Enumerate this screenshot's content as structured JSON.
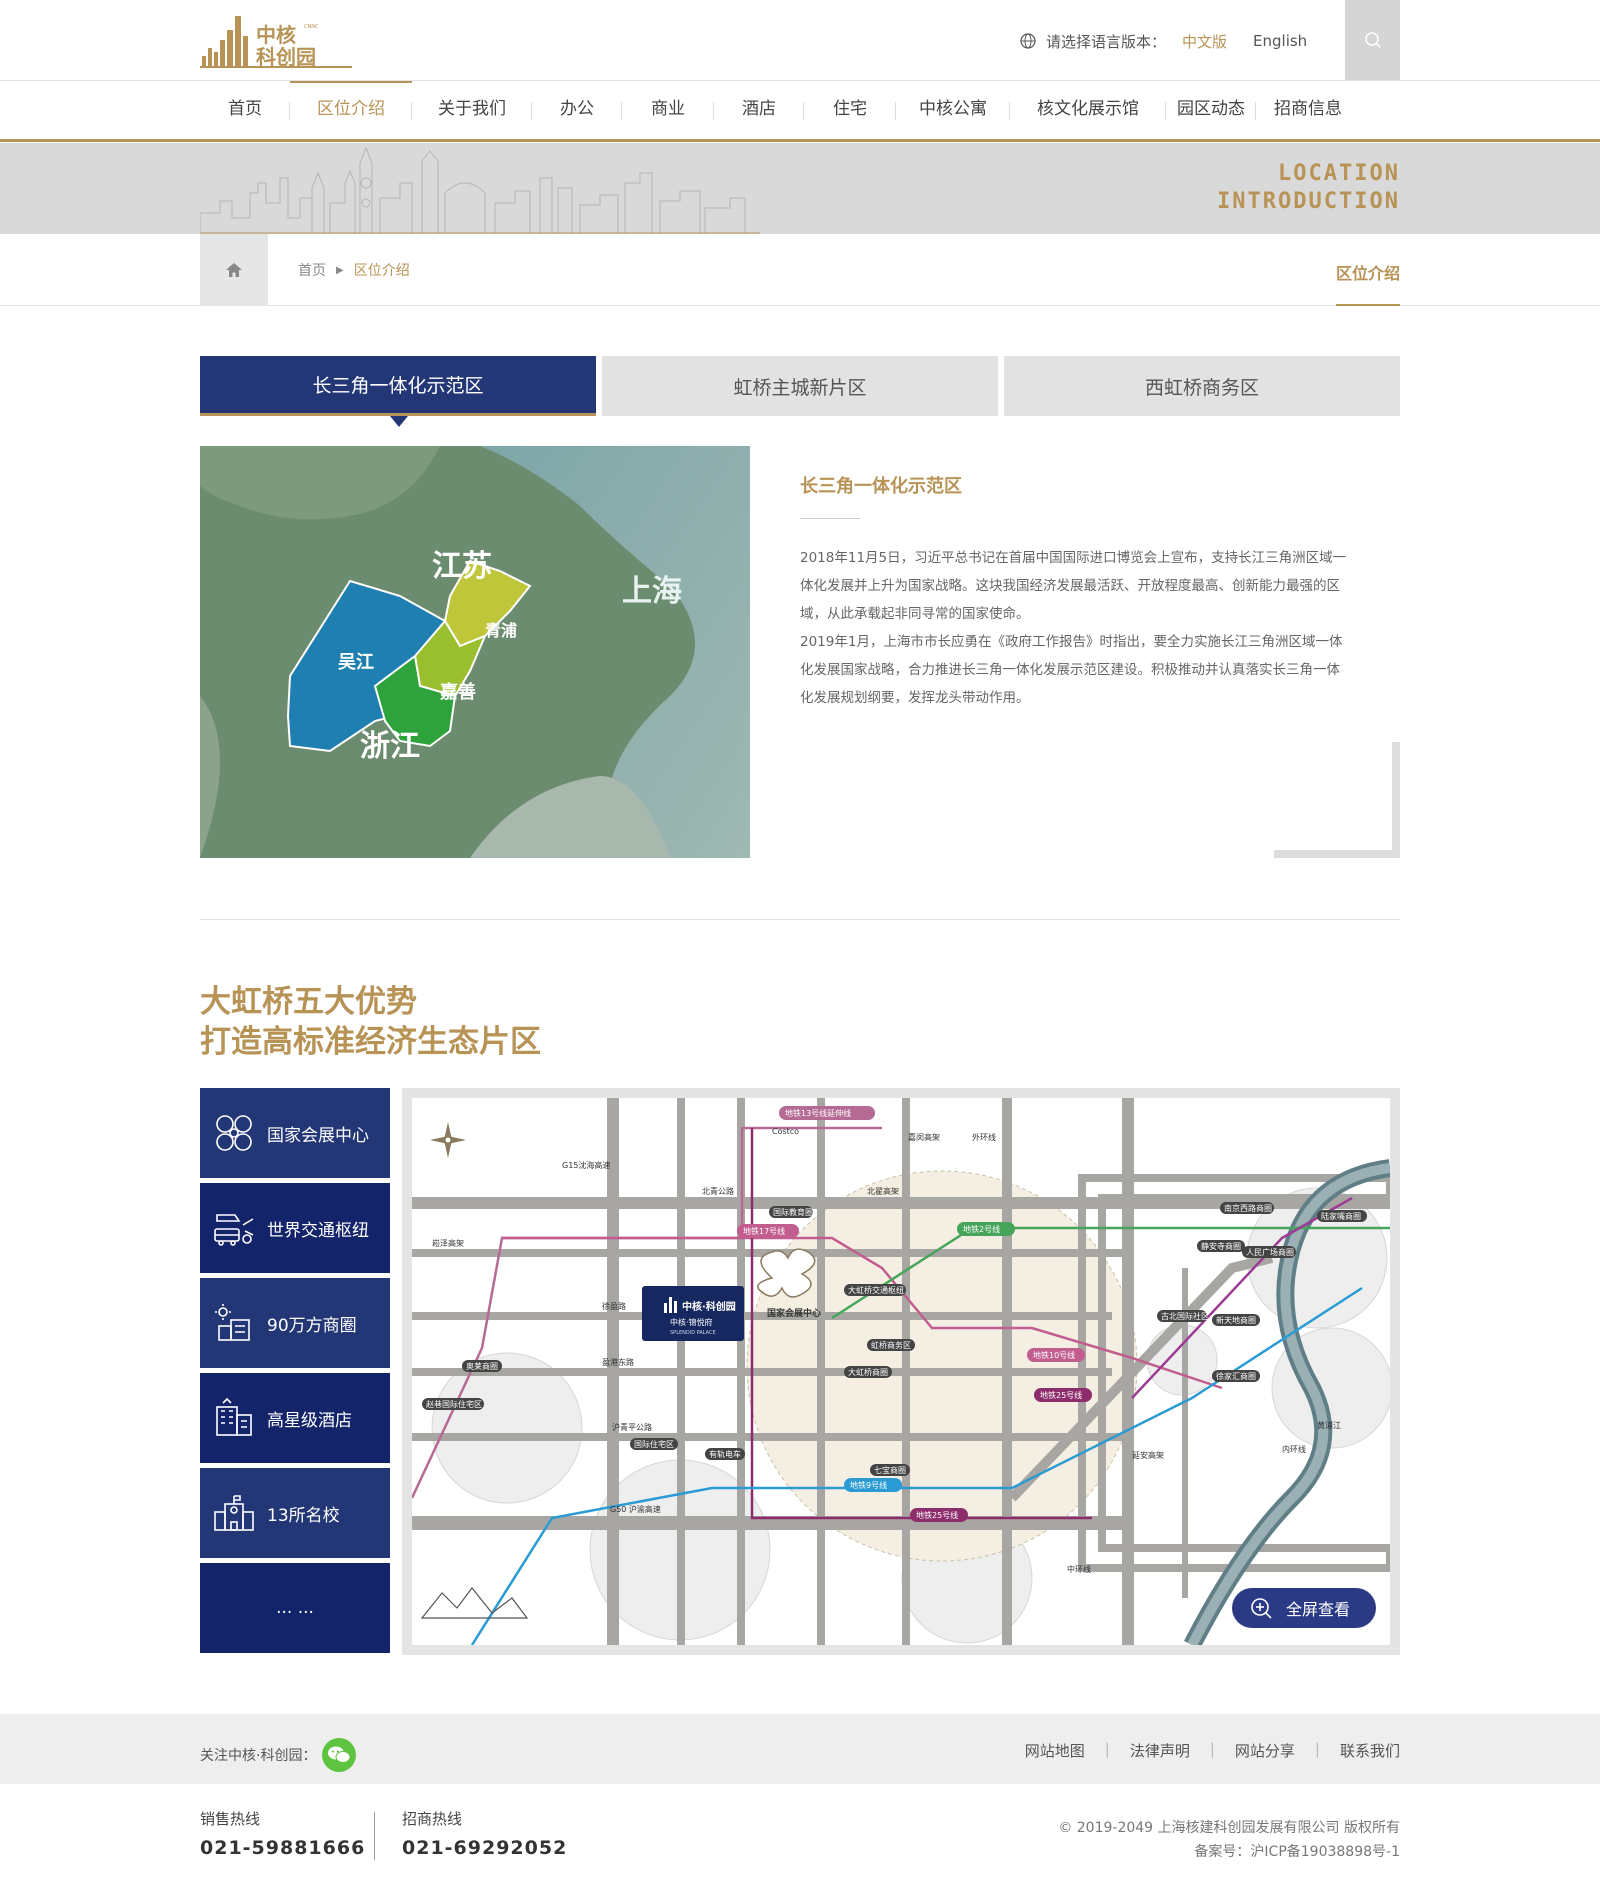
{
  "header": {
    "logo_text_cn": "中核科创园",
    "lang_label": "请选择语言版本：",
    "lang_cn": "中文版",
    "lang_en": "English"
  },
  "nav": {
    "items": [
      "首页",
      "区位介绍",
      "关于我们",
      "办公",
      "商业",
      "酒店",
      "住宅",
      "中核公寓",
      "核文化展示馆",
      "园区动态",
      "招商信息"
    ],
    "active_index": 1
  },
  "banner": {
    "line1": "LOCATION",
    "line2": "INTRODUCTION"
  },
  "breadcrumb": {
    "home": "首页",
    "current": "区位介绍",
    "section_title": "区位介绍"
  },
  "tabs": [
    {
      "label": "长三角一体化示范区",
      "active": true
    },
    {
      "label": "虹桥主城新片区",
      "active": false
    },
    {
      "label": "西虹桥商务区",
      "active": false
    }
  ],
  "region_map": {
    "labels": {
      "jiangsu": "江苏",
      "shanghai": "上海",
      "qingpu": "青浦",
      "wujiang": "吴江",
      "jiashan": "嘉善",
      "zhejiang": "浙江"
    }
  },
  "intro": {
    "title": "长三角一体化示范区",
    "p1": "2018年11月5日，习近平总书记在首届中国国际进口博览会上宣布，支持长江三角洲区域一体化发展并上升为国家战略。这块我国经济发展最活跃、开放程度最高、创新能力最强的区域，从此承载起非同寻常的国家使命。",
    "p2": "2019年1月，上海市市长应勇在《政府工作报告》时指出，要全力实施长江三角洲区域一体化发展国家战略，合力推进长三角一体化发展示范区建设。积极推动并认真落实长三角一体化发展规划纲要，发挥龙头带动作用。"
  },
  "advantages": {
    "heading1": "大虹桥五大优势",
    "heading2": "打造高标准经济生态片区",
    "items": [
      {
        "label": "国家会展中心",
        "icon": "expo-center-icon"
      },
      {
        "label": "世界交通枢纽",
        "icon": "transport-hub-icon"
      },
      {
        "label": "90万方商圈",
        "icon": "shopping-district-icon"
      },
      {
        "label": "高星级酒店",
        "icon": "hotel-icon"
      },
      {
        "label": "13所名校",
        "icon": "school-icon"
      },
      {
        "label": "... ...",
        "icon": ""
      }
    ]
  },
  "bigmap": {
    "roads": {
      "beiqing": "北青公路",
      "beizhai": "北翟高架",
      "songze": "崧泽高架",
      "xuying": "徐盈路",
      "yinggang": "盈港东路",
      "huqing": "沪青平公路",
      "g50": "G50 沪渝高速",
      "g15": "G15沈海高速",
      "jiamin": "嘉闵高架",
      "zhonghuan": "中环线",
      "waihuan": "外环线",
      "neihuan": "内环线",
      "yanan": "延安高架",
      "huangpu": "黄浦江"
    },
    "places": {
      "expo": "国家会展中心",
      "hongqiao_hub": "大虹桥交通枢纽",
      "hongqiao_cbd": "虹桥商务区",
      "dahongqiao": "大虹桥商圈",
      "intl_edu": "国际教育圈",
      "aolai": "奥莱商圈",
      "zhaoxiang": "赵巷国际住宅区",
      "intl_res": "国际住宅区",
      "youguidianche": "有轨电车",
      "qibao": "七宝商圈",
      "gubei": "古北国际社区",
      "xintiandi": "新天地商圈",
      "xujiahui": "徐家汇商圈",
      "nanjingxi": "南京西路商圈",
      "jingan": "静安寺商圈",
      "renmin": "人民广场商圈",
      "lujiazui": "陆家嘴商圈",
      "costco": "Costco"
    },
    "metro": {
      "l13": "地铁13号线延伸线",
      "l17": "地铁17号线",
      "l2": "地铁2号线",
      "l10": "地铁10号线",
      "l25": "地铁25号线",
      "l9": "地铁9号线",
      "l25b": "地铁25号线"
    },
    "logo_cn": "中核·科创园",
    "logo_sub": "中核·锦悦府",
    "logo_en": "SPLENDID PALACE"
  },
  "fullscreen_label": "全屏查看",
  "footer": {
    "follow": "关注中核·科创园：",
    "links": [
      "网站地图",
      "法律声明",
      "网站分享",
      "联系我们"
    ],
    "sales_label": "销售热线",
    "sales_num": "021-59881666",
    "invest_label": "招商热线",
    "invest_num": "021-69292052",
    "copyright": "© 2019-2049 上海核建科创园发展有限公司 版权所有",
    "icp": "备案号：沪ICP备19038898号-1"
  },
  "colors": {
    "gold": "#b89356",
    "navy": "#233777",
    "navy_dark": "#14246a",
    "gray": "#e2e2e2"
  }
}
